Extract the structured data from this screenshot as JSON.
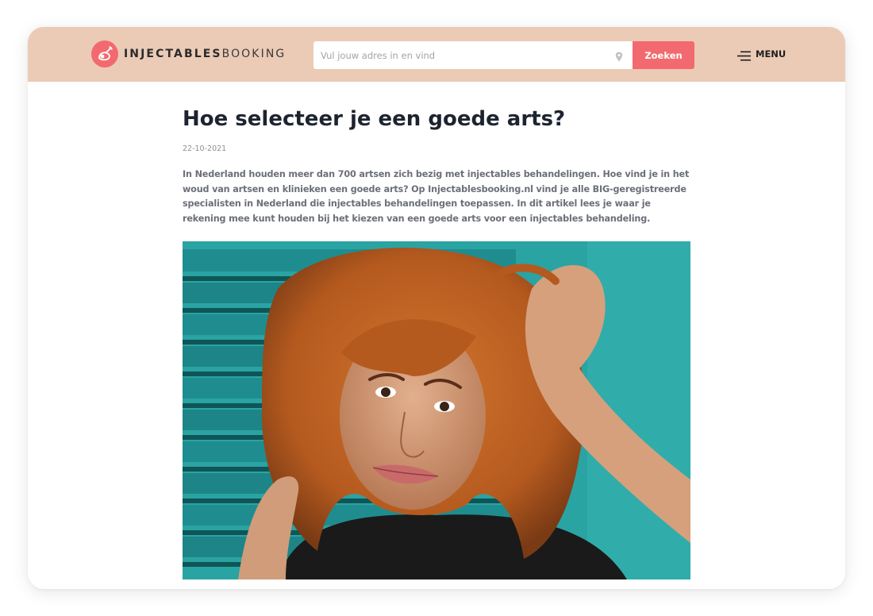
{
  "colors": {
    "header_bg": "#ebcbb6",
    "accent": "#f26a6f"
  },
  "header": {
    "logo": {
      "icon": "injectables-logo-icon",
      "brand_bold": "INJECTABLES",
      "brand_light": "BOOKING"
    },
    "search": {
      "placeholder": "Vul jouw adres in en vind",
      "value": "",
      "location_icon": "map-pin-icon",
      "button_label": "Zoeken"
    },
    "menu": {
      "icon": "hamburger-menu-icon",
      "label": "MENU"
    }
  },
  "article": {
    "title": "Hoe selecteer je een goede arts?",
    "date": "22-10-2021",
    "intro": "In Nederland houden meer dan 700 artsen zich bezig met injectables behandelingen. Hoe vind je in het woud van artsen en klinieken een goede arts? Op Injectablesbooking.nl vind je alle BIG-geregistreerde specialisten in Nederland die injectables behandelingen toepassen. In dit artikel lees je waar je rekening mee kunt houden bij het kiezen van een goede arts voor een injectables behandeling.",
    "hero_image": {
      "subject": "smiling-woman-curly-red-hair-photo",
      "background": "teal-window-shutters"
    }
  }
}
